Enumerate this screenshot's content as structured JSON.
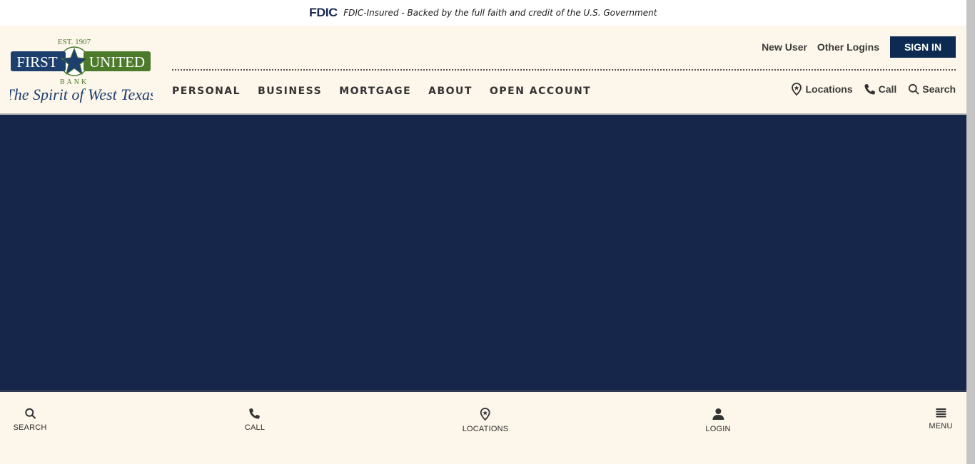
{
  "fdic": {
    "logo_text": "FDIC",
    "tagline": "FDIC-Insured - Backed by the full faith and credit of the U.S. Government"
  },
  "brand": {
    "name_left": "FIRST",
    "name_right": "UNITED",
    "est": "EST. 1907",
    "bank": "BANK",
    "slogan": "The Spirit of West Texas",
    "colors": {
      "green": "#4a7a2a",
      "navy": "#1d3f6e",
      "hero": "#15264a",
      "signin": "#0d2b52",
      "cream": "#fdf6ea"
    }
  },
  "header": {
    "top_links": {
      "new_user": "New User",
      "other_logins": "Other Logins",
      "sign_in": "SIGN IN"
    },
    "main_nav": [
      "PERSONAL",
      "BUSINESS",
      "MORTGAGE",
      "ABOUT",
      "OPEN ACCOUNT"
    ],
    "utility_nav": {
      "locations": "Locations",
      "call": "Call",
      "search": "Search"
    }
  },
  "bottom_bar": {
    "search": "SEARCH",
    "call": "CALL",
    "locations": "LOCATIONS",
    "login": "LOGIN",
    "menu": "MENU"
  }
}
